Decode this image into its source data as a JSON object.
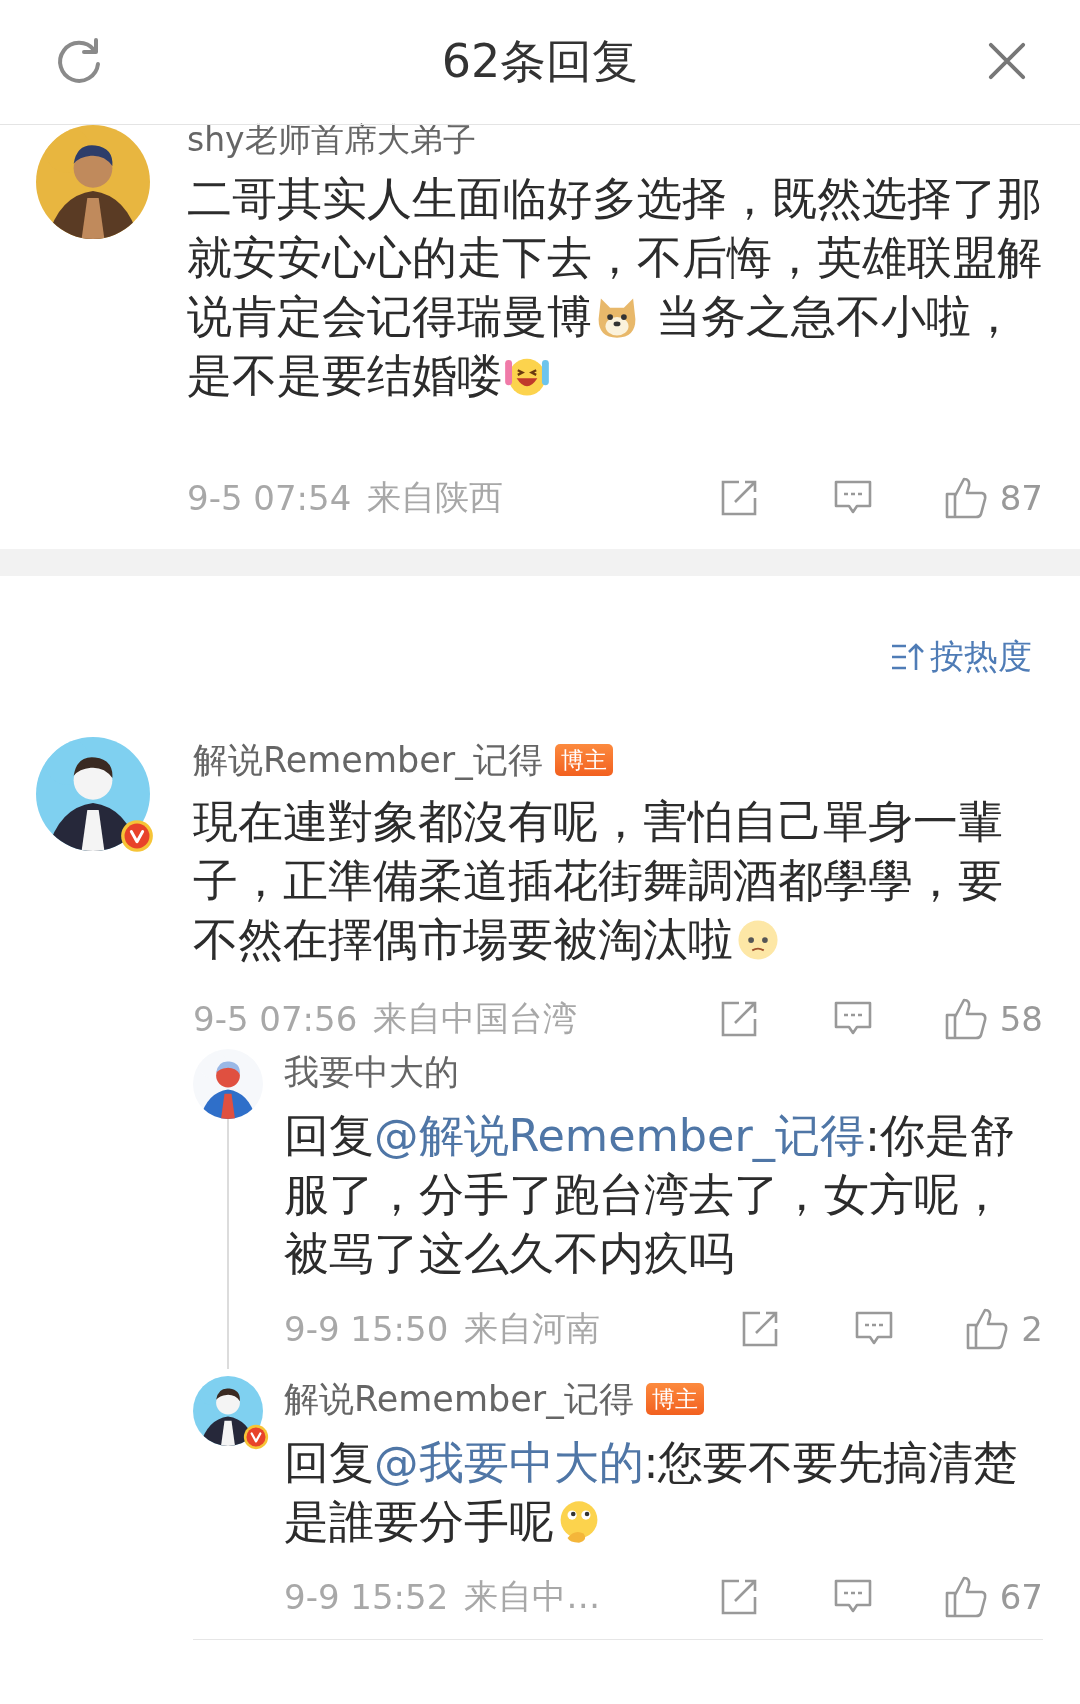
{
  "header": {
    "title": "62条回复"
  },
  "top_comment": {
    "user": "shy老师首席大弟子",
    "verified": false,
    "body": [
      {
        "kind": "text",
        "text": "二哥其实人生面临好多选择，既然选择了那就安安心心的走下去，不后悔，英雄联盟解说肯定会记得瑞曼博"
      },
      {
        "kind": "doge"
      },
      {
        "kind": "text",
        "text": " 当务之急不小啦，是不是要结婚喽"
      },
      {
        "kind": "laugh"
      }
    ],
    "time": "9-5 07:54",
    "location": "来自陕西",
    "likes": "87"
  },
  "sort": {
    "label": "按热度"
  },
  "comments": [
    {
      "user": "解说Remember_记得",
      "tag": "博主",
      "verified": true,
      "body": [
        {
          "kind": "text",
          "text": "現在連對象都沒有呢，害怕自己單身一輩子，正準備柔道插花街舞調酒都學學，要不然在擇偶市場要被淘汰啦"
        },
        {
          "kind": "sad"
        }
      ],
      "time": "9-5 07:56",
      "location": "来自中国台湾",
      "likes": "58",
      "replies": [
        {
          "user": "我要中大的",
          "verified": false,
          "body": [
            {
              "kind": "text",
              "text": "回复"
            },
            {
              "kind": "mention",
              "text": "@解说Remember_记得"
            },
            {
              "kind": "text",
              "text": ":你是舒服了，分手了跑台湾去了，女方呢，被骂了这么久不内疚吗"
            }
          ],
          "time": "9-9 15:50",
          "location": "来自河南",
          "likes": "2"
        },
        {
          "user": "解说Remember_记得",
          "tag": "博主",
          "verified": true,
          "body": [
            {
              "kind": "text",
              "text": "回复"
            },
            {
              "kind": "mention",
              "text": "@我要中大的"
            },
            {
              "kind": "text",
              "text": ":您要不要先搞清楚是誰要分手呢"
            },
            {
              "kind": "think"
            }
          ],
          "time": "9-9 15:52",
          "location": "来自中…",
          "likes": "67"
        }
      ]
    }
  ]
}
